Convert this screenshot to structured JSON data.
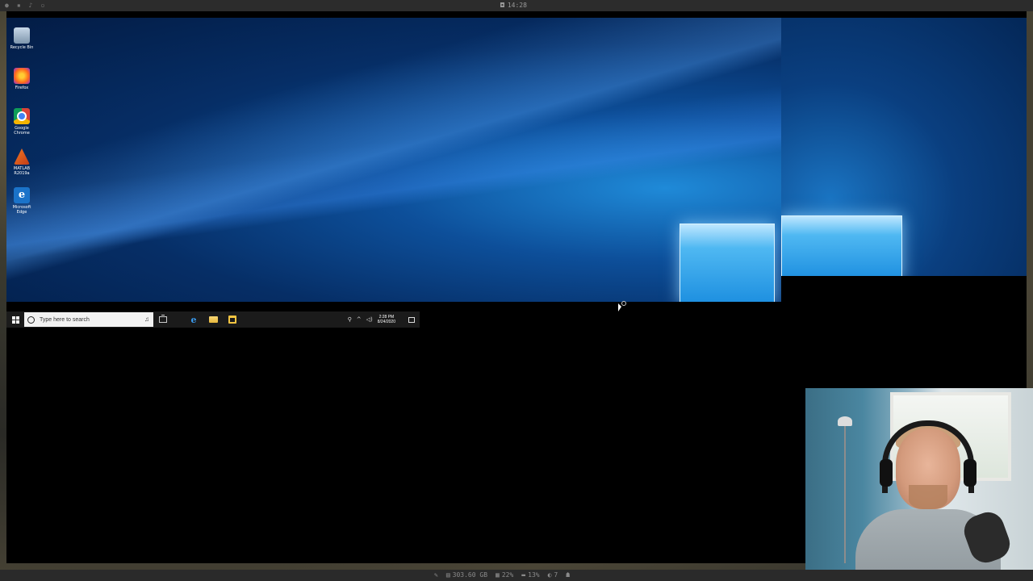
{
  "host": {
    "top_clock": "14:28",
    "bottom_stats": [
      {
        "icon": "disk-icon",
        "value": "303.60 GB"
      },
      {
        "icon": "cpu-icon",
        "value": "22%"
      },
      {
        "icon": "memory-icon",
        "value": "13%"
      },
      {
        "icon": "network-icon",
        "value": "7"
      }
    ]
  },
  "desktop": {
    "icons": [
      {
        "name": "recycle-bin",
        "label": "Recycle Bin"
      },
      {
        "name": "firefox",
        "label": "Firefox"
      },
      {
        "name": "google-chrome",
        "label": "Google Chrome"
      },
      {
        "name": "matlab",
        "label": "MATLAB R2019a"
      },
      {
        "name": "microsoft-edge",
        "label": "Microsoft Edge"
      }
    ]
  },
  "taskbar": {
    "search_placeholder": "Type here to search",
    "time": "2:28 PM",
    "date": "8/24/2020"
  },
  "colors": {
    "accent": "#1d8fe0",
    "taskbar": "#1b1b1b"
  }
}
